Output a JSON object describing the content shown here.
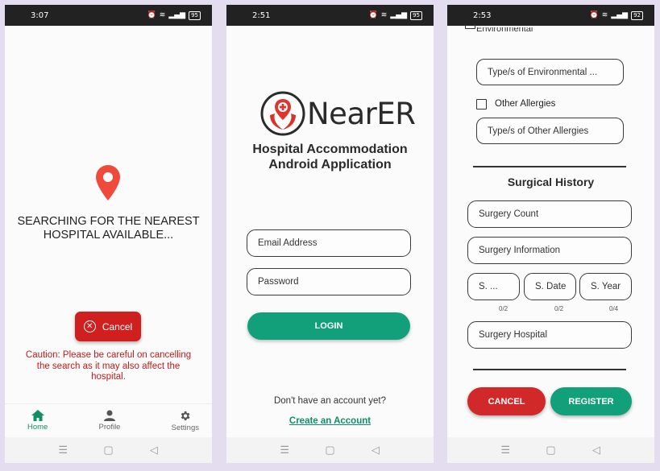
{
  "screen1": {
    "time": "3:07",
    "battery": "95",
    "searching_text": "SEARCHING FOR THE NEAREST HOSPITAL AVAILABLE...",
    "cancel_label": "Cancel",
    "caution_text": "Caution: Please be careful on cancelling the search as it may also affect the hospital.",
    "tabs": [
      {
        "label": "Home",
        "icon": "home-icon",
        "active": true
      },
      {
        "label": "Profile",
        "icon": "person-icon",
        "active": false
      },
      {
        "label": "Settings",
        "icon": "gear-icon",
        "active": false
      }
    ],
    "accent": "#0f8f63",
    "pin_color": "#ef4a3c"
  },
  "screen2": {
    "time": "2:51",
    "battery": "95",
    "logo_text": "NearER",
    "app_subtitle_line1": "Hospital Accommodation",
    "app_subtitle_line2": "Android Application",
    "email_placeholder": "Email Address",
    "password_placeholder": "Password",
    "login_label": "LOGIN",
    "no_account_text": "Don't have an account yet?",
    "create_account_label": "Create an Account"
  },
  "screen3": {
    "time": "2:53",
    "battery": "92",
    "cutoff_label": "Environmental",
    "environmental_placeholder": "Type/s of Environmental ...",
    "other_allergies_label": "Other Allergies",
    "other_allergies_placeholder": "Type/s of Other Allergies",
    "section_title": "Surgical History",
    "surgery_count_placeholder": "Surgery Count",
    "surgery_info_placeholder": "Surgery Information",
    "s_short_placeholder": "S. ...",
    "s_date_placeholder": "S. Date",
    "s_year_placeholder": "S. Year",
    "counter_1": "0/2",
    "counter_2": "0/2",
    "counter_3": "0/4",
    "surgery_hospital_placeholder": "Surgery Hospital",
    "cancel_label": "CANCEL",
    "register_label": "REGISTER"
  },
  "nav_glyphs": {
    "menu": "☰",
    "home": "▢",
    "back": "◁"
  }
}
